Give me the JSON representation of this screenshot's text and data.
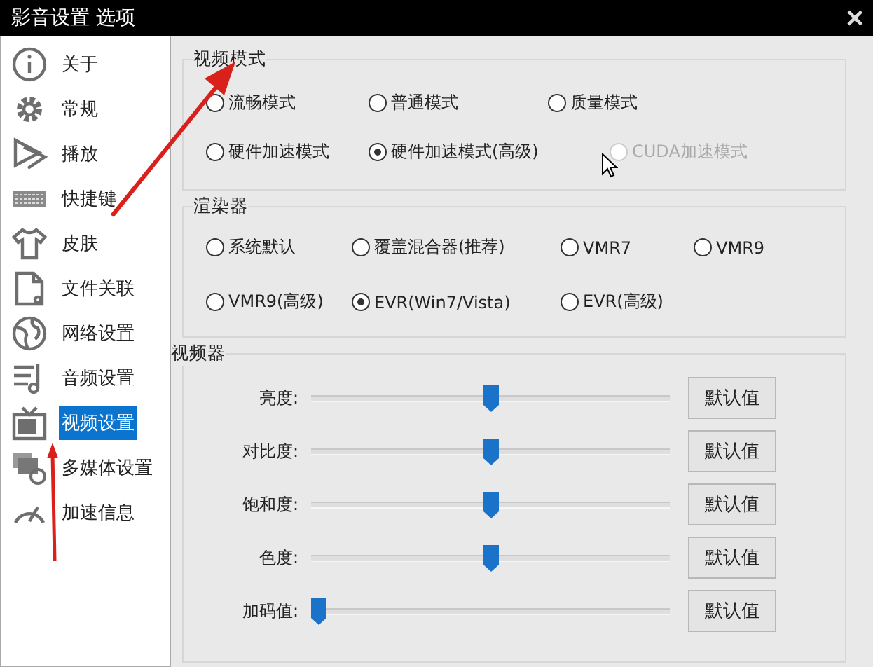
{
  "window": {
    "title": "影音设置 选项",
    "close": "✕"
  },
  "sidebar": {
    "items": [
      {
        "label": "关于",
        "selected": false
      },
      {
        "label": "常规",
        "selected": false
      },
      {
        "label": "播放",
        "selected": false
      },
      {
        "label": "快捷键",
        "selected": false
      },
      {
        "label": "皮肤",
        "selected": false
      },
      {
        "label": "文件关联",
        "selected": false
      },
      {
        "label": "网络设置",
        "selected": false
      },
      {
        "label": "音频设置",
        "selected": false
      },
      {
        "label": "视频设置",
        "selected": true
      },
      {
        "label": "多媒体设置",
        "selected": false
      },
      {
        "label": "加速信息",
        "selected": false
      }
    ]
  },
  "video_mode": {
    "title": "视频模式",
    "options": [
      {
        "label": "流畅模式",
        "selected": false,
        "disabled": false
      },
      {
        "label": "普通模式",
        "selected": false,
        "disabled": false
      },
      {
        "label": "质量模式",
        "selected": false,
        "disabled": false
      },
      {
        "label": "硬件加速模式",
        "selected": false,
        "disabled": false
      },
      {
        "label": "硬件加速模式(高级)",
        "selected": true,
        "disabled": false
      },
      {
        "label": "CUDA加速模式",
        "selected": false,
        "disabled": true
      }
    ]
  },
  "renderer": {
    "title": "渲染器",
    "options": [
      {
        "label": "系统默认",
        "selected": false,
        "disabled": false
      },
      {
        "label": "覆盖混合器(推荐)",
        "selected": false,
        "disabled": false
      },
      {
        "label": "VMR7",
        "selected": false,
        "disabled": false
      },
      {
        "label": "VMR9",
        "selected": false,
        "disabled": false
      },
      {
        "label": "VMR9(高级)",
        "selected": false,
        "disabled": false
      },
      {
        "label": "EVR(Win7/Vista)",
        "selected": true,
        "disabled": false
      },
      {
        "label": "EVR(高级)",
        "selected": false,
        "disabled": false
      }
    ]
  },
  "video": {
    "title": "视频器",
    "sliders": [
      {
        "label": "亮度:",
        "level": 0.5,
        "button": "默认值"
      },
      {
        "label": "对比度:",
        "level": 0.5,
        "button": "默认值"
      },
      {
        "label": "饱和度:",
        "level": 0.5,
        "button": "默认值"
      },
      {
        "label": "色度:",
        "level": 0.5,
        "button": "默认值"
      },
      {
        "label": "加码值:",
        "level": 0,
        "button": "默认值"
      }
    ]
  }
}
